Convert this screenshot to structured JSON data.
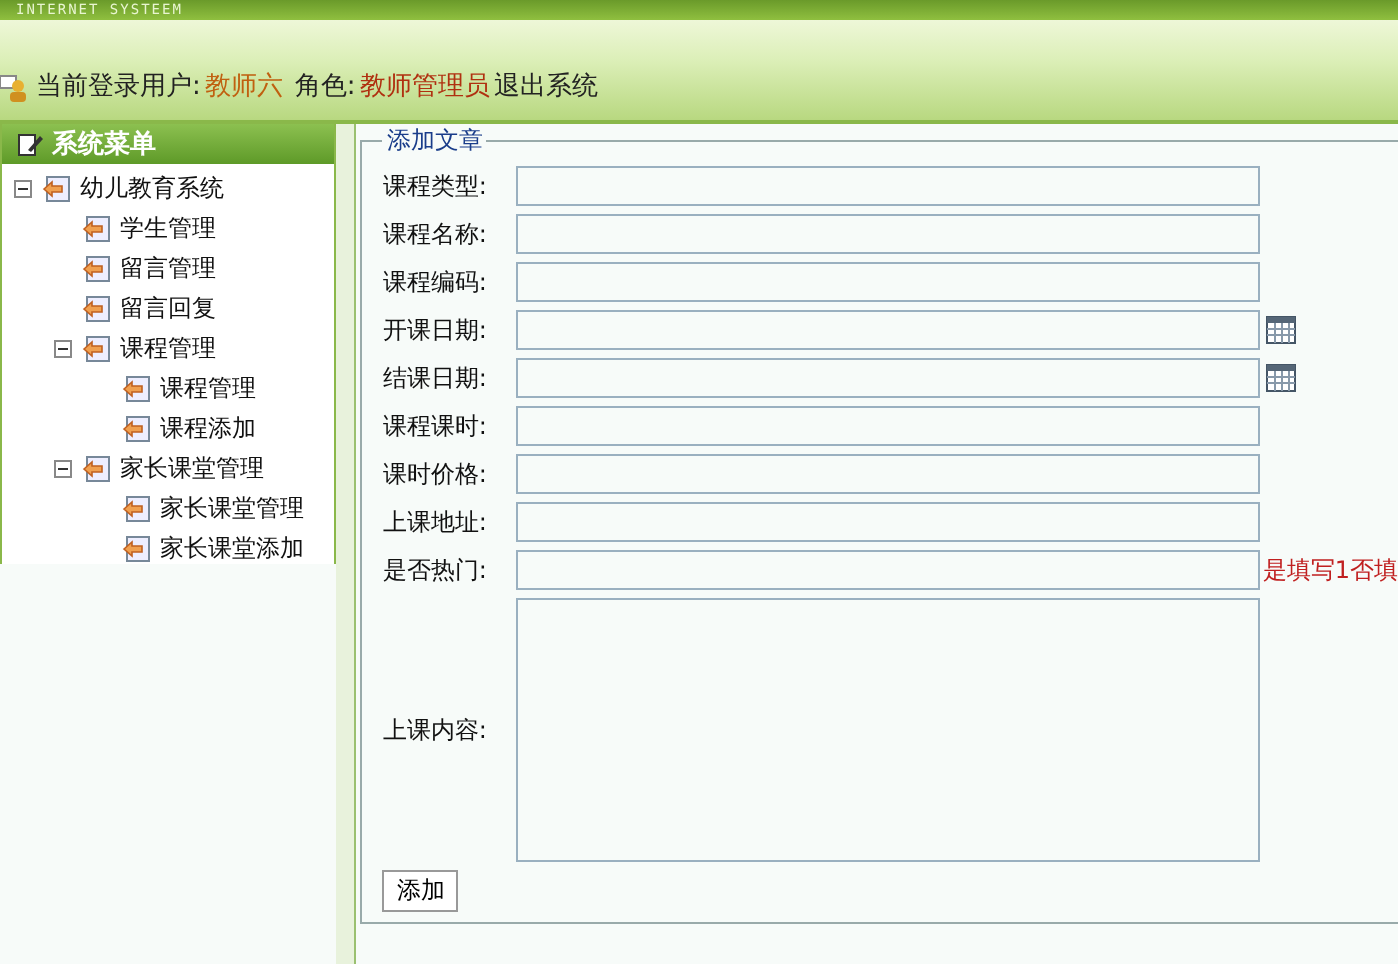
{
  "header": {
    "brand": "INTERNET SYSTEEM",
    "user_label": "当前登录用户:",
    "user_name": "教师六",
    "role_label": "角色:",
    "role_name": "教师管理员",
    "logout": "退出系统"
  },
  "sidebar": {
    "title": "系统菜单",
    "tree": [
      {
        "label": "幼儿教育系统",
        "expanded": true,
        "children": [
          {
            "label": "学生管理"
          },
          {
            "label": "留言管理"
          },
          {
            "label": "留言回复"
          },
          {
            "label": "课程管理",
            "expanded": true,
            "children": [
              {
                "label": "课程管理"
              },
              {
                "label": "课程添加"
              }
            ]
          },
          {
            "label": "家长课堂管理",
            "expanded": true,
            "children": [
              {
                "label": "家长课堂管理"
              },
              {
                "label": "家长课堂添加"
              }
            ]
          }
        ]
      }
    ]
  },
  "form": {
    "legend": "添加文章",
    "fields": [
      {
        "label": "课程类型:",
        "kind": "text"
      },
      {
        "label": "课程名称:",
        "kind": "text"
      },
      {
        "label": "课程编码:",
        "kind": "text"
      },
      {
        "label": "开课日期:",
        "kind": "date"
      },
      {
        "label": "结课日期:",
        "kind": "date"
      },
      {
        "label": "课程课时:",
        "kind": "text"
      },
      {
        "label": "课时价格:",
        "kind": "text"
      },
      {
        "label": "上课地址:",
        "kind": "text"
      },
      {
        "label": "是否热门:",
        "kind": "text",
        "hint": "是填写1否填"
      },
      {
        "label": "上课内容:",
        "kind": "textarea"
      }
    ],
    "submit": "添加"
  }
}
